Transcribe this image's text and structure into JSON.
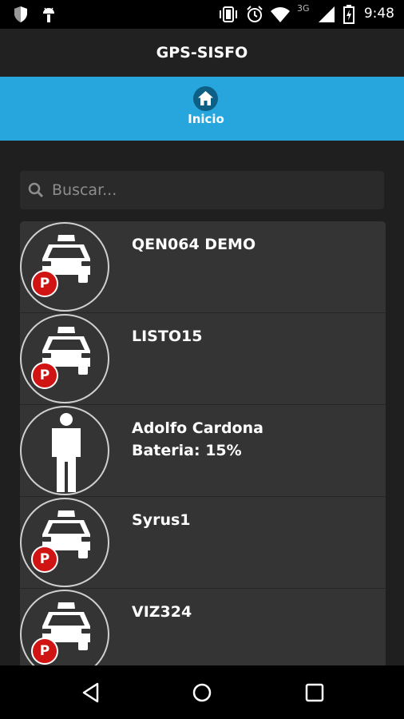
{
  "status_bar": {
    "time": "9:48",
    "network": "3G",
    "icons": [
      "shield-icon",
      "android-icon",
      "vibrate-icon",
      "alarm-icon",
      "wifi-icon",
      "signal-icon",
      "battery-charging-icon"
    ]
  },
  "app_bar": {
    "title": "GPS-SISFO"
  },
  "tabs": [
    {
      "label": "Inicio",
      "icon": "home-icon"
    }
  ],
  "search": {
    "placeholder": "Buscar...",
    "value": ""
  },
  "items": [
    {
      "name": "QEN064 DEMO",
      "type": "vehicle",
      "badge": "P"
    },
    {
      "name": "LISTO15",
      "type": "vehicle",
      "badge": "P"
    },
    {
      "name": "Adolfo Cardona",
      "sub": "Bateria: 15%",
      "type": "person"
    },
    {
      "name": "Syrus1",
      "type": "vehicle",
      "badge": "P"
    },
    {
      "name": "VIZ324",
      "type": "vehicle",
      "badge": "P"
    }
  ],
  "nav_bar": {
    "icons": [
      "back-icon",
      "home-circle-icon",
      "recents-icon"
    ]
  },
  "colors": {
    "accent": "#27a6dd",
    "badge": "#d01414",
    "background": "#1f1f1f",
    "card": "#343434"
  }
}
